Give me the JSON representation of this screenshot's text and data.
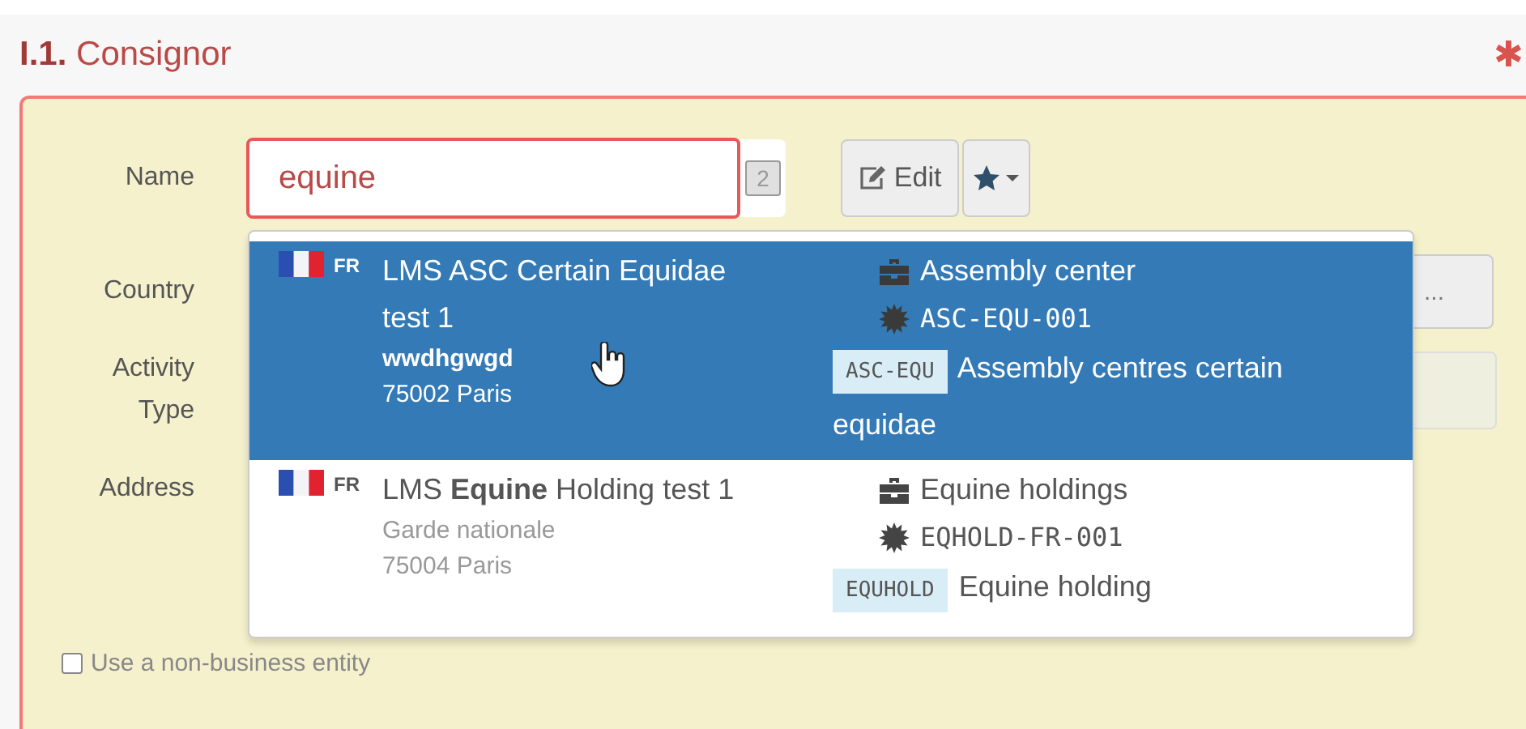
{
  "section": {
    "number": "I.1.",
    "title": "Consignor",
    "required_mark": "✱"
  },
  "form": {
    "name_label": "Name",
    "name_value": "equine",
    "result_count": "2",
    "edit_button": "Edit",
    "country_label": "Country",
    "country_button": "...",
    "activity_label": "Activity Type",
    "address_label": "Address",
    "non_business": {
      "label": "Use a non-business entity",
      "checked": false
    }
  },
  "results": [
    {
      "selected": true,
      "country": "FR",
      "name": "LMS ASC Certain Equidae test 1",
      "address": [
        "wwdhgwgd",
        "75002 Paris"
      ],
      "activity": "Assembly center",
      "code": "ASC-EQU-001",
      "badge": "ASC-EQU",
      "description": "Assembly centres certain equidae"
    },
    {
      "selected": false,
      "country": "FR",
      "name": "LMS **Equine** Holding test 1",
      "address": [
        "Garde nationale",
        "75004 Paris"
      ],
      "activity": "Equine holdings",
      "code": "EQHOLD-FR-001",
      "badge": "EQUHOLD",
      "description": "Equine holding"
    }
  ]
}
